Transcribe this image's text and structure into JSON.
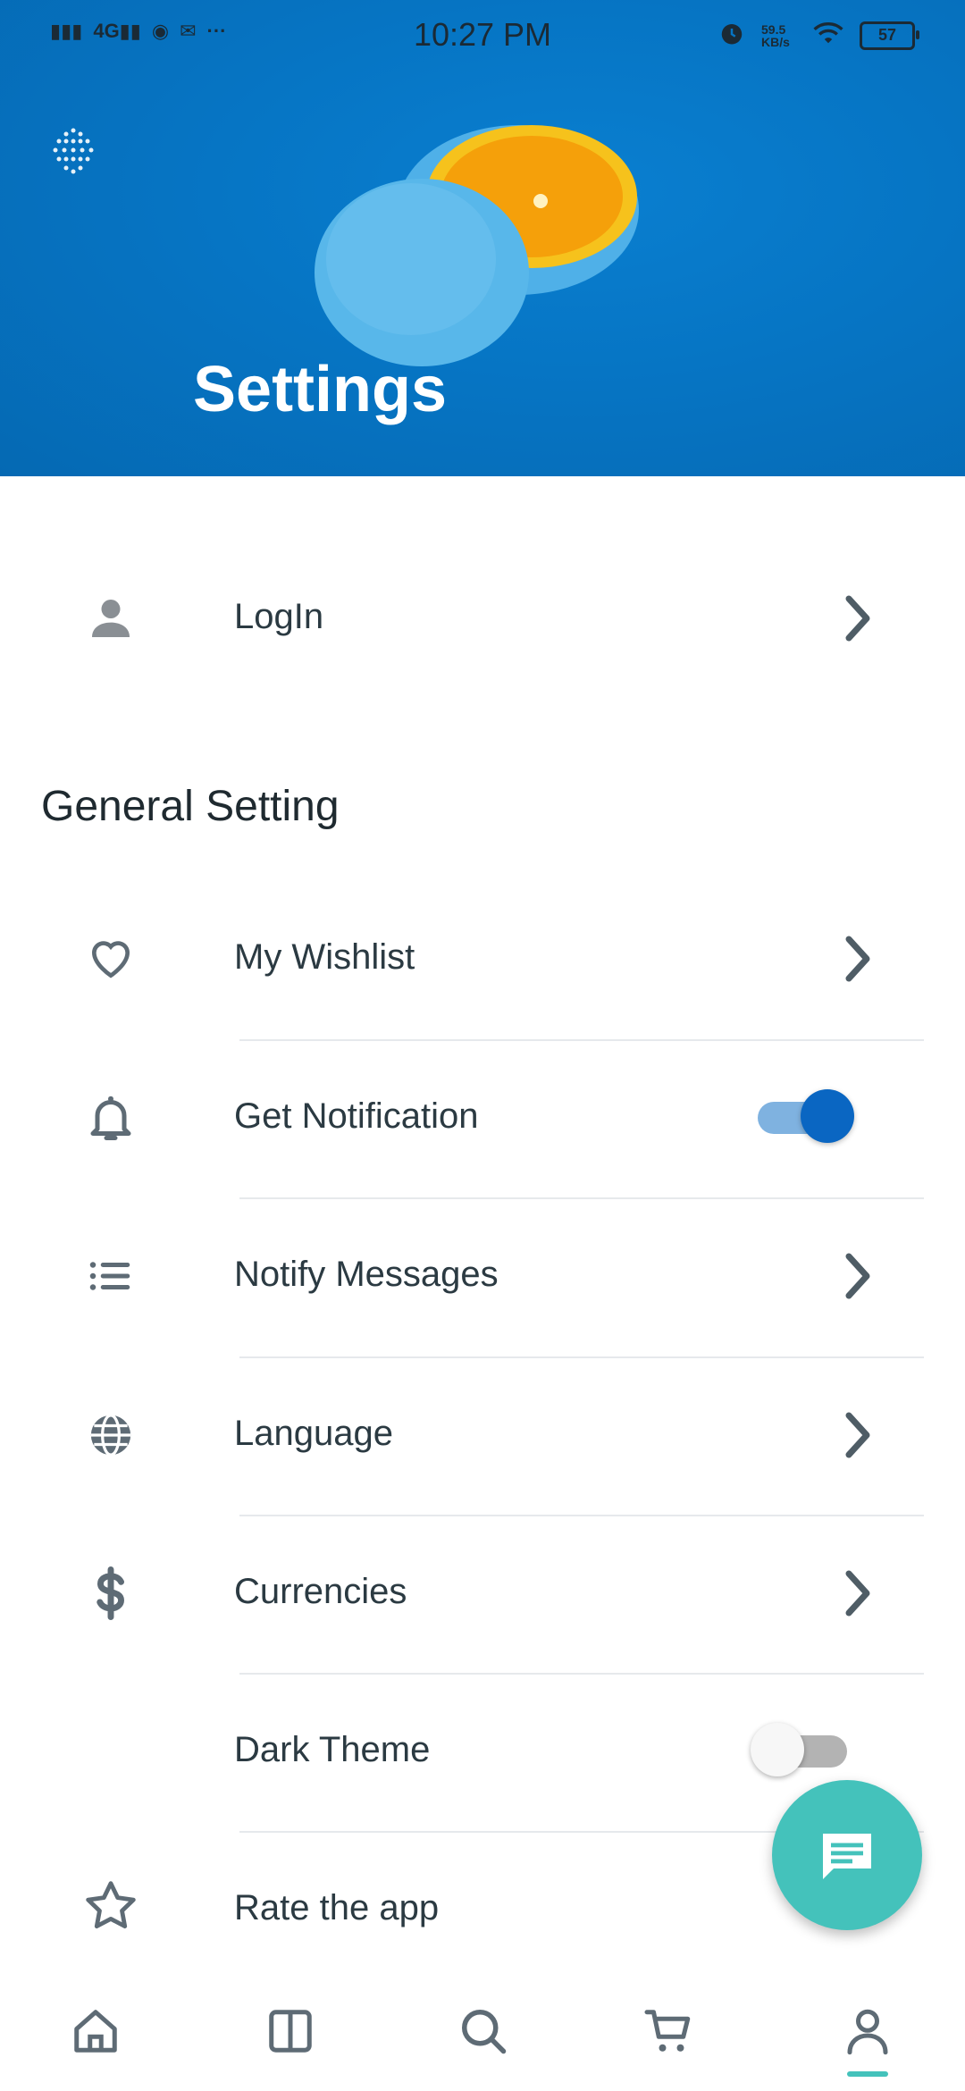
{
  "statusbar": {
    "left": "H 4G ◉ ✉ ···",
    "time": "10:27 PM",
    "speed": "59.5 KB/s",
    "battery": "57"
  },
  "header": {
    "title": "Settings"
  },
  "login": {
    "label": "LogIn",
    "icon": "person-icon"
  },
  "general": {
    "section_title": "General Setting",
    "items": [
      {
        "label": "My Wishlist",
        "icon": "heart-icon",
        "control": "chevron"
      },
      {
        "label": "Get Notification",
        "icon": "bell-icon",
        "control": "toggle",
        "on": true
      },
      {
        "label": "Notify Messages",
        "icon": "list-icon",
        "control": "chevron"
      },
      {
        "label": "Language",
        "icon": "globe-icon",
        "control": "chevron"
      },
      {
        "label": "Currencies",
        "icon": "dollar-icon",
        "control": "chevron"
      },
      {
        "label": "Dark Theme",
        "icon": "moon-icon",
        "control": "toggle",
        "on": false
      },
      {
        "label": "Rate the app",
        "icon": "star-icon",
        "control": "none"
      }
    ]
  },
  "fab": {
    "icon": "chat-icon"
  },
  "bottom_nav": {
    "items": [
      "home-icon",
      "columns-icon",
      "search-icon",
      "cart-icon",
      "profile-icon"
    ],
    "active": "profile-icon"
  },
  "colors": {
    "header_blue": "#0675c4",
    "accent_teal": "#44c2bb",
    "toggle_on": "#0a66c2",
    "icon_gray": "#5e6b75"
  }
}
